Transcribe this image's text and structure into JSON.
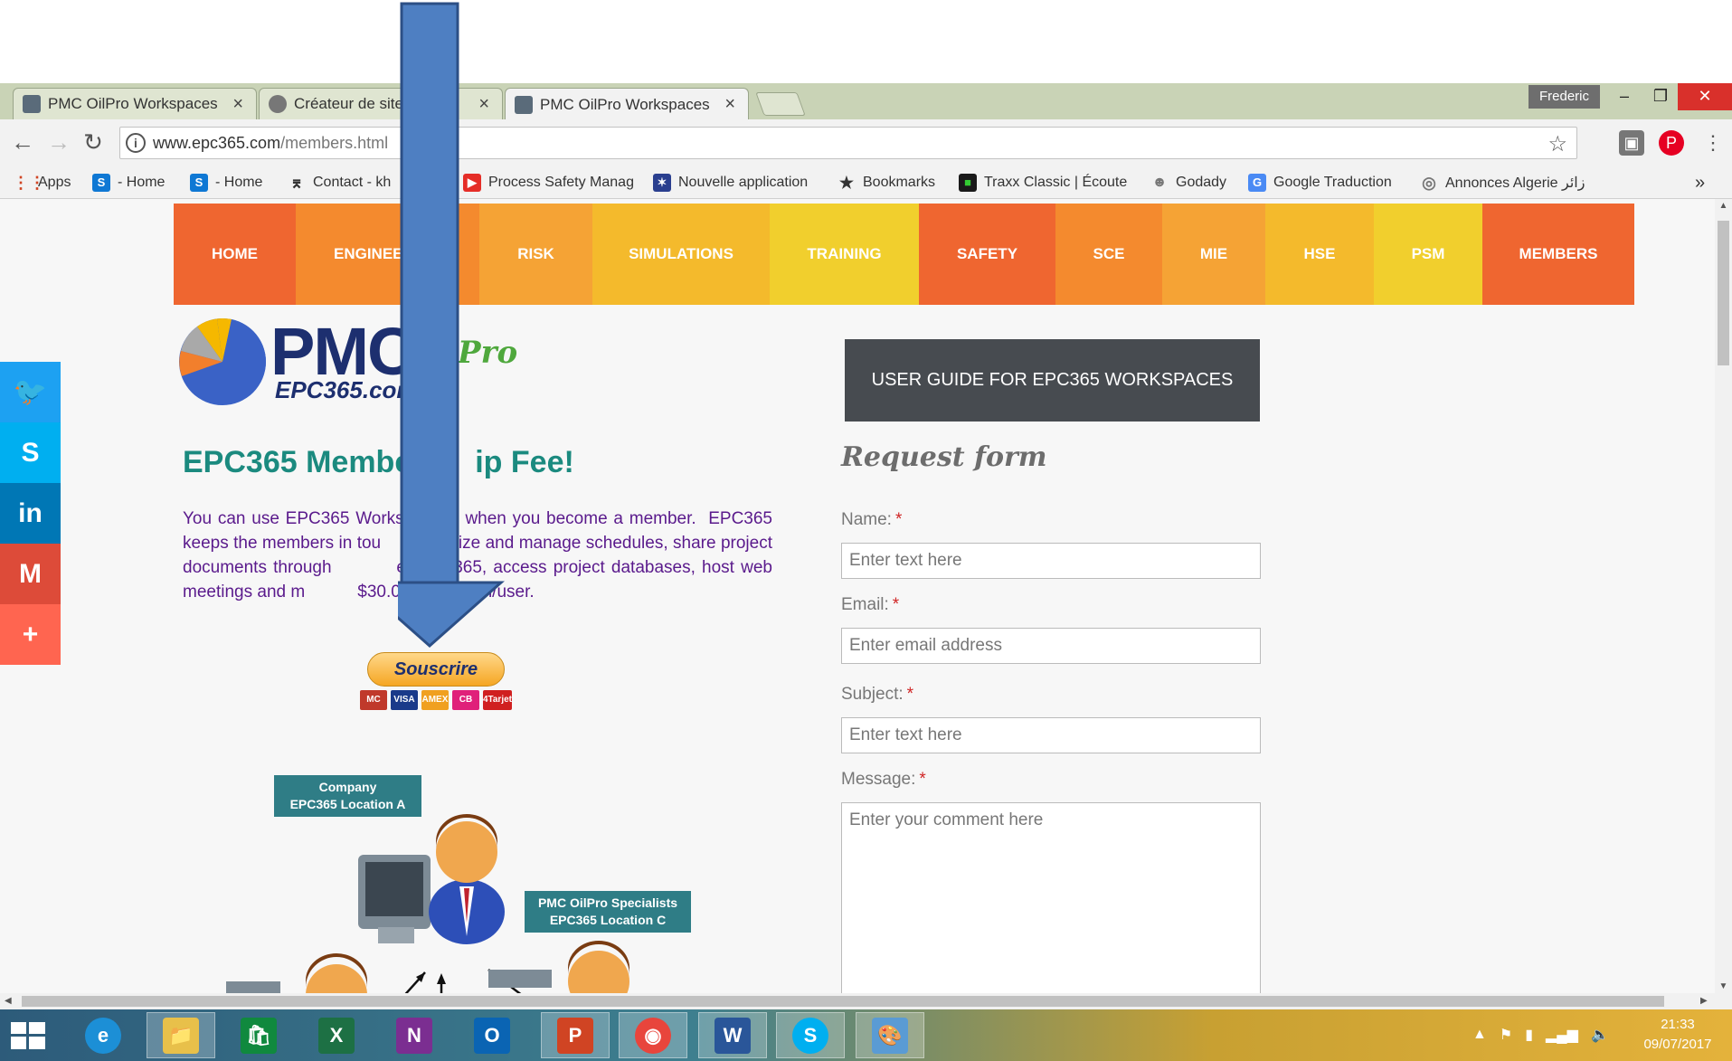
{
  "browser": {
    "tabs": [
      {
        "title": "PMC OilPro Workspaces",
        "close": "×"
      },
      {
        "title": "Créateur de site",
        "close": "×"
      },
      {
        "title": "PMC OilPro Workspaces",
        "close": "×"
      }
    ],
    "profile": "Frederic",
    "window_buttons": {
      "minimize": "–",
      "restore": "❐",
      "close": "✕"
    },
    "nav": {
      "back": "←",
      "forward": "→",
      "reload": "↻"
    },
    "url_host": "www.epc365.com",
    "url_path": "/members.html",
    "bookmarks": [
      {
        "label": "Apps"
      },
      {
        "label": "- Home"
      },
      {
        "label": "- Home"
      },
      {
        "label": "Contact - kh"
      },
      {
        "label": "Process Safety Manag"
      },
      {
        "label": "Nouvelle application"
      },
      {
        "label": "Bookmarks"
      },
      {
        "label": "Traxx Classic | Écoute"
      },
      {
        "label": "Godady"
      },
      {
        "label": "Google Traduction"
      },
      {
        "label": "Annonces Algerie زائر"
      }
    ],
    "bookmarks_more": "»"
  },
  "menu": [
    {
      "label": "HOME",
      "color": "#ef6630"
    },
    {
      "label": "ENGINEERING",
      "color": "#f48a2e"
    },
    {
      "label": "RISK",
      "color": "#f5a335"
    },
    {
      "label": "SIMULATIONS",
      "color": "#f4ba2c"
    },
    {
      "label": "TRAINING",
      "color": "#f1cf2d"
    },
    {
      "label": "SAFETY",
      "color": "#ef6630"
    },
    {
      "label": "SCE",
      "color": "#f48a2e"
    },
    {
      "label": "MIE",
      "color": "#f5a335"
    },
    {
      "label": "HSE",
      "color": "#f4ba2c"
    },
    {
      "label": "PSM",
      "color": "#f1cf2d"
    },
    {
      "label": "MEMBERS",
      "color": "#ef6630"
    }
  ],
  "social": [
    {
      "icon": "twitter-icon",
      "glyph": "🐦",
      "color": "#1da1f2"
    },
    {
      "icon": "skype-icon",
      "glyph": "S",
      "color": "#00aff0"
    },
    {
      "icon": "linkedin-icon",
      "glyph": "in",
      "color": "#0077b5"
    },
    {
      "icon": "gmail-icon",
      "glyph": "M",
      "color": "#dd4b39"
    },
    {
      "icon": "more-share-icon",
      "glyph": "+",
      "color": "#ff6550"
    }
  ],
  "logo": {
    "main": "PMC",
    "sub": "EPC365.com",
    "pro": "Pro"
  },
  "heading": "EPC365 Membe",
  "heading_tail": "ip Fee!",
  "intro": "You can use EPC365 Works          when you become a member.  EPC365 keeps the members in tou          ganize and manage schedules, share project documents through          e office365, access project databases, host web meetings and m           $30.00 per month/user.",
  "subscribe": {
    "label": "Souscrire",
    "cards": [
      "MC",
      "VISA",
      "AMEX",
      "CB",
      "4Tarjet"
    ]
  },
  "diagram": {
    "label_a": "Company\nEPC365 Location A",
    "label_c": "PMC OilPro Specialists\nEPC365 Location C"
  },
  "guide_button": "USER GUIDE FOR EPC365 WORKSPACES",
  "form": {
    "title": "Request form",
    "required_mark": "*",
    "name_label": "Name:",
    "name_placeholder": "Enter text here",
    "email_label": "Email:",
    "email_placeholder": "Enter email address",
    "subject_label": "Subject:",
    "subject_placeholder": "Enter text here",
    "message_label": "Message:",
    "message_placeholder": "Enter your comment here"
  },
  "taskbar": {
    "apps": [
      {
        "name": "internet-explorer-icon",
        "glyph": "e",
        "color": "#1c8fd6"
      },
      {
        "name": "file-explorer-icon",
        "glyph": "📁",
        "color": "#e8c04a"
      },
      {
        "name": "store-icon",
        "glyph": "🛍",
        "color": "#10893e"
      },
      {
        "name": "excel-icon",
        "glyph": "X",
        "color": "#1d7044"
      },
      {
        "name": "onenote-icon",
        "glyph": "N",
        "color": "#7b2e91"
      },
      {
        "name": "outlook-icon",
        "glyph": "O",
        "color": "#0a64b3"
      },
      {
        "name": "powerpoint-icon",
        "glyph": "P",
        "color": "#d04423"
      },
      {
        "name": "chrome-icon",
        "glyph": "◉",
        "color": "#e8453c"
      },
      {
        "name": "word-icon",
        "glyph": "W",
        "color": "#2a5699"
      },
      {
        "name": "skype-icon",
        "glyph": "S",
        "color": "#00aff0"
      },
      {
        "name": "paint-icon",
        "glyph": "🎨",
        "color": "#5a9bd4"
      }
    ],
    "time": "21:33",
    "date": "09/07/2017"
  }
}
